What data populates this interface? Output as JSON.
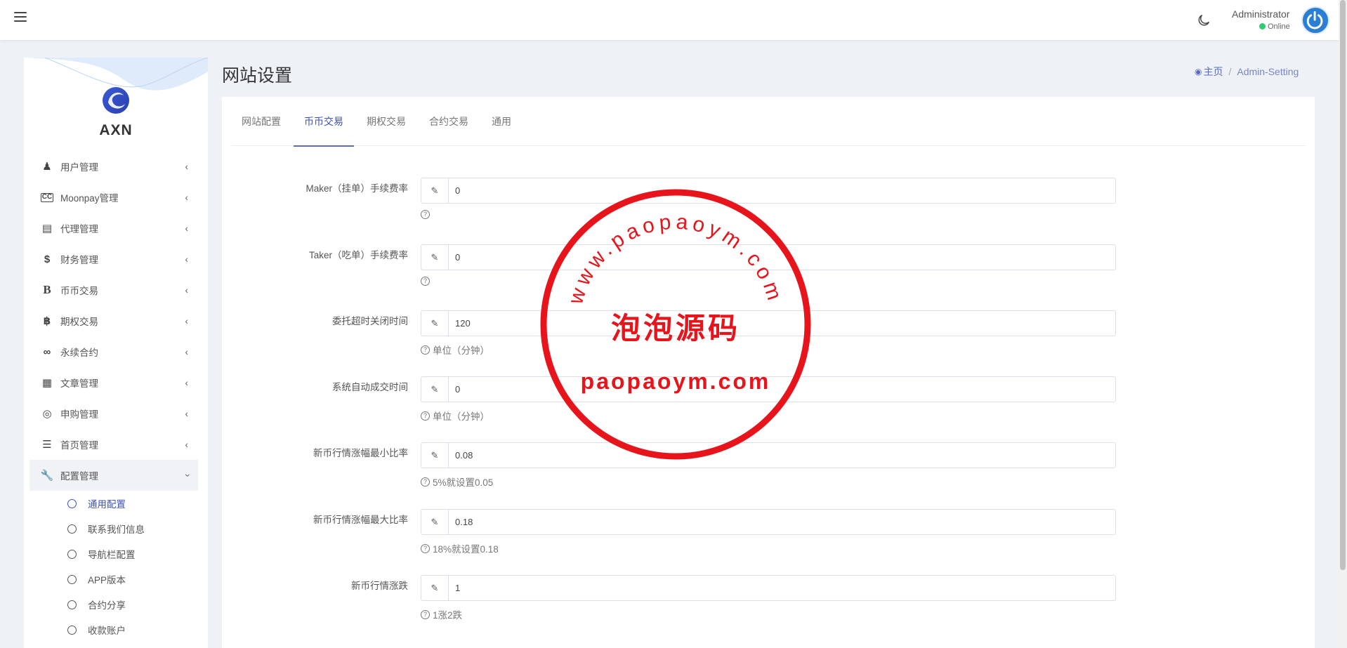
{
  "topbar": {
    "user_name": "Administrator",
    "user_status": "Online"
  },
  "sidebar": {
    "logo_text": "AXN",
    "items": [
      {
        "label": "用户管理",
        "icon": "user-group-icon"
      },
      {
        "label": "Moonpay管理",
        "icon": "cc-icon"
      },
      {
        "label": "代理管理",
        "icon": "id-card-icon"
      },
      {
        "label": "财务管理",
        "icon": "dollar-icon"
      },
      {
        "label": "币币交易",
        "icon": "bold-b-icon"
      },
      {
        "label": "期权交易",
        "icon": "bitcoin-icon"
      },
      {
        "label": "永续合约",
        "icon": "link-icon"
      },
      {
        "label": "文章管理",
        "icon": "newspaper-icon"
      },
      {
        "label": "申购管理",
        "icon": "life-ring-icon"
      },
      {
        "label": "首页管理",
        "icon": "list-icon"
      },
      {
        "label": "配置管理",
        "icon": "wrench-icon"
      }
    ],
    "submenu": [
      {
        "label": "通用配置"
      },
      {
        "label": "联系我们信息"
      },
      {
        "label": "导航栏配置"
      },
      {
        "label": "APP版本"
      },
      {
        "label": "合约分享"
      },
      {
        "label": "收款账户"
      }
    ]
  },
  "header": {
    "title": "网站设置",
    "breadcrumb_home": "主页",
    "breadcrumb_current": "Admin-Setting"
  },
  "tabs": [
    {
      "label": "网站配置"
    },
    {
      "label": "币币交易"
    },
    {
      "label": "期权交易"
    },
    {
      "label": "合约交易"
    },
    {
      "label": "通用"
    }
  ],
  "fields": [
    {
      "label": "Maker（挂单）手续费率",
      "value": "0",
      "help": ""
    },
    {
      "label": "Taker（吃单）手续费率",
      "value": "0",
      "help": ""
    },
    {
      "label": "委托超时关闭时间",
      "value": "120",
      "help": "单位（分钟）"
    },
    {
      "label": "系统自动成交时间",
      "value": "0",
      "help": "单位（分钟）"
    },
    {
      "label": "新币行情涨幅最小比率",
      "value": "0.08",
      "help": "5%就设置0.05"
    },
    {
      "label": "新币行情涨幅最大比率",
      "value": "0.18",
      "help": "18%就设置0.18"
    },
    {
      "label": "新币行情涨跌",
      "value": "1",
      "help": "1涨2跌"
    }
  ],
  "watermark": {
    "url_text": "www.paopaoym.com",
    "center_text": "泡泡源码",
    "bottom_text": "paopaoym.com",
    "color": "#e8141b"
  }
}
